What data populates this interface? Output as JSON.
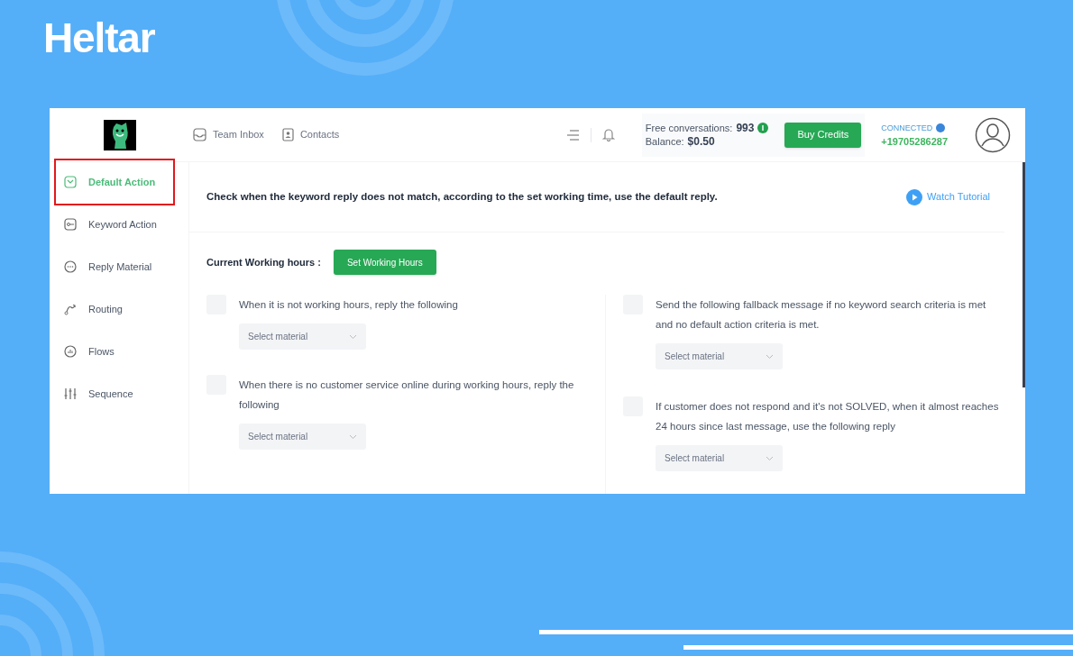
{
  "brand": "Heltar",
  "header": {
    "nav": [
      {
        "label": "Team Inbox"
      },
      {
        "label": "Contacts"
      }
    ],
    "free_label": "Free conversations:",
    "free_count": "993",
    "balance_label": "Balance:",
    "balance": "$0.50",
    "buy_button": "Buy Credits",
    "connection": "CONNECTED",
    "phone": "+19705286287"
  },
  "sidebar": {
    "items": [
      {
        "label": "Default Action",
        "selected": true,
        "highlighted": true
      },
      {
        "label": "Keyword Action",
        "selected": false,
        "highlighted": false
      },
      {
        "label": "Reply Material",
        "selected": false,
        "highlighted": false
      },
      {
        "label": "Routing",
        "selected": false,
        "highlighted": false
      },
      {
        "label": "Flows",
        "selected": false,
        "highlighted": false
      },
      {
        "label": "Sequence",
        "selected": false,
        "highlighted": false
      }
    ]
  },
  "main": {
    "intro": "Check when the keyword reply does not match, according to the set working time, use the default reply.",
    "watch_tutorial": "Watch Tutorial",
    "working_hours_label": "Current Working hours :",
    "set_hours_button": "Set Working Hours",
    "left_rules": [
      {
        "text": "When it is not working hours, reply the following",
        "checked": false,
        "placeholder": "Select material"
      },
      {
        "text": "When there is no customer service online during working hours, reply the following",
        "checked": false,
        "placeholder": "Select material"
      }
    ],
    "right_rules": [
      {
        "text": "Send the following fallback message if no keyword search criteria is met and no default action criteria is met.",
        "checked": false,
        "placeholder": "Select material"
      },
      {
        "text": "If customer does not respond and it's not SOLVED, when it almost reaches 24 hours since last message, use the following reply",
        "checked": false,
        "placeholder": "Select material"
      }
    ]
  }
}
